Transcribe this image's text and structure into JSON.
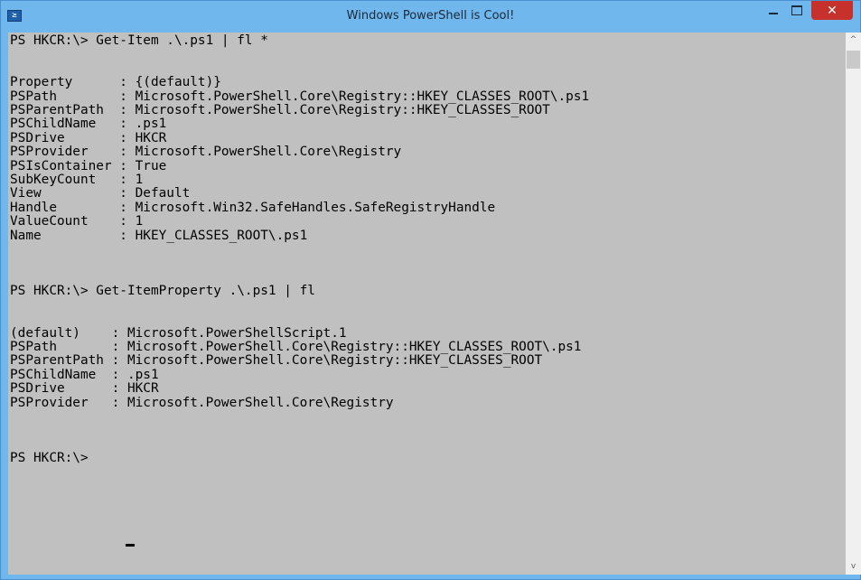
{
  "window": {
    "title": "Windows PowerShell is Cool!",
    "icon": "powershell-icon",
    "icon_glyph": "≥"
  },
  "controls": {
    "close_glyph": "✕"
  },
  "console": {
    "text": "PS HKCR:\\> Get-Item .\\.ps1 | fl *\n\n\nProperty      : {(default)}\nPSPath        : Microsoft.PowerShell.Core\\Registry::HKEY_CLASSES_ROOT\\.ps1\nPSParentPath  : Microsoft.PowerShell.Core\\Registry::HKEY_CLASSES_ROOT\nPSChildName   : .ps1\nPSDrive       : HKCR\nPSProvider    : Microsoft.PowerShell.Core\\Registry\nPSIsContainer : True\nSubKeyCount   : 1\nView          : Default\nHandle        : Microsoft.Win32.SafeHandles.SafeRegistryHandle\nValueCount    : 1\nName          : HKEY_CLASSES_ROOT\\.ps1\n\n\n\nPS HKCR:\\> Get-ItemProperty .\\.ps1 | fl\n\n\n(default)    : Microsoft.PowerShellScript.1\nPSPath       : Microsoft.PowerShell.Core\\Registry::HKEY_CLASSES_ROOT\\.ps1\nPSParentPath : Microsoft.PowerShell.Core\\Registry::HKEY_CLASSES_ROOT\nPSChildName  : .ps1\nPSDrive      : HKCR\nPSProvider   : Microsoft.PowerShell.Core\\Registry\n\n\n\nPS HKCR:\\> ",
    "background": "#c0c0c0",
    "foreground": "#000000"
  },
  "scrollbar": {
    "up_glyph": "^",
    "down_glyph": "v"
  },
  "colors": {
    "titlebar": "#6fb7ec",
    "close_button": "#c7312b"
  }
}
